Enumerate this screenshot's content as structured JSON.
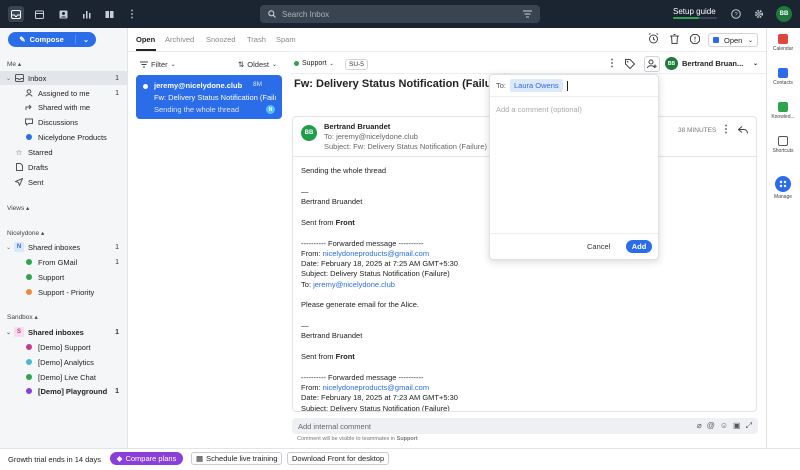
{
  "search": {
    "placeholder": "Search Inbox"
  },
  "header": {
    "setup_guide": "Setup guide",
    "avatar_initials": "BB",
    "setup_progress": 0.6
  },
  "compose": {
    "label": "Compose"
  },
  "sidebar": {
    "me_label": "Me",
    "inbox": {
      "label": "Inbox",
      "count": "1"
    },
    "me_items": [
      {
        "label": "Assigned to me",
        "count": "1"
      },
      {
        "label": "Shared with me"
      },
      {
        "label": "Discussions"
      },
      {
        "label": "Nicelydone Products"
      }
    ],
    "starred": "Starred",
    "drafts": "Drafts",
    "sent": "Sent",
    "views_label": "Views",
    "nicelydone_label": "Nicelydone",
    "nd_shared": {
      "label": "Shared inboxes",
      "count": "1"
    },
    "nd_items": [
      {
        "label": "From GMail",
        "count": "1",
        "color": "#2ea44f"
      },
      {
        "label": "Support",
        "color": "#2ea44f"
      },
      {
        "label": "Support - Priority",
        "color": "#f0883e"
      }
    ],
    "sandbox_label": "Sandbox",
    "sb_shared": {
      "label": "Shared inboxes",
      "count": "1"
    },
    "sb_items": [
      {
        "label": "[Demo] Support",
        "color": "#c23b8c"
      },
      {
        "label": "[Demo] Analytics",
        "color": "#4fb3d9"
      },
      {
        "label": "[Demo] Live Chat",
        "color": "#2ea44f"
      },
      {
        "label": "[Demo] Playground",
        "count": "1",
        "color": "#8b3fd9"
      }
    ]
  },
  "tabs": [
    "Open",
    "Archived",
    "Snoozed",
    "Trash",
    "Spam"
  ],
  "filters": {
    "filter": "Filter",
    "sort": "Oldest"
  },
  "message_card": {
    "from": "jeremy@nicelydone.club",
    "time": "8M",
    "subject": "Fw: Delivery Status Notification (Failure)",
    "preview": "Sending the whole thread",
    "badge": "N"
  },
  "conversation": {
    "status": "Open",
    "assignee": "Bertrand Bruan...",
    "assignee_initials": "BB",
    "tag": "Support",
    "ticket": "SU-5",
    "title": "Fw: Delivery Status Notification (Failure)"
  },
  "message": {
    "avatar": "BB",
    "sender": "Bertrand Bruandet",
    "to": "To: jeremy@nicelydone.club",
    "subject": "Subject: Fw: Delivery Status Notification (Failure)",
    "time": "38 MINUTES",
    "body": [
      "Sending the whole thread",
      "—",
      "Bertrand Bruandet",
      "Sent from Front",
      "---------- Forwarded message ----------",
      "From: nicelydoneproducts@gmail.com",
      "Date: February 18, 2025 at 7:25 AM GMT+5:30",
      "Subject: Delivery Status Notification (Failure)",
      "To: jeremy@nicelydone.club",
      "Please generate email for the Alice.",
      "—",
      "Bertrand Bruandet",
      "Sent from Front",
      "---------- Forwarded message ----------",
      "From: nicelydoneproducts@gmail.com",
      "Date: February 18, 2025 at 7:23 AM GMT+5:30",
      "Subject: Delivery Status Notification (Failure)"
    ]
  },
  "comment_popup": {
    "to_label": "To:",
    "recipient": "Laura Owens",
    "placeholder": "Add a comment (optional)",
    "cancel": "Cancel",
    "add": "Add"
  },
  "internal_comment": {
    "placeholder": "Add internal comment",
    "note_prefix": "Comment will be visible to teammates in",
    "note_inbox": "Support"
  },
  "rail": [
    {
      "label": "Calendar",
      "color": "#e0463c"
    },
    {
      "label": "Contacts",
      "color": "#2b6de8"
    },
    {
      "label": "Knowled...",
      "color": "#2ea44f"
    },
    {
      "label": "Shortcuts",
      "color": "#555555"
    },
    {
      "label": "Manage",
      "color": "#2b6de8"
    }
  ],
  "bottom": {
    "trial": "Growth trial ends in 14 days",
    "compare": "Compare plans",
    "schedule": "Schedule live training",
    "download": "Download Front for desktop"
  }
}
